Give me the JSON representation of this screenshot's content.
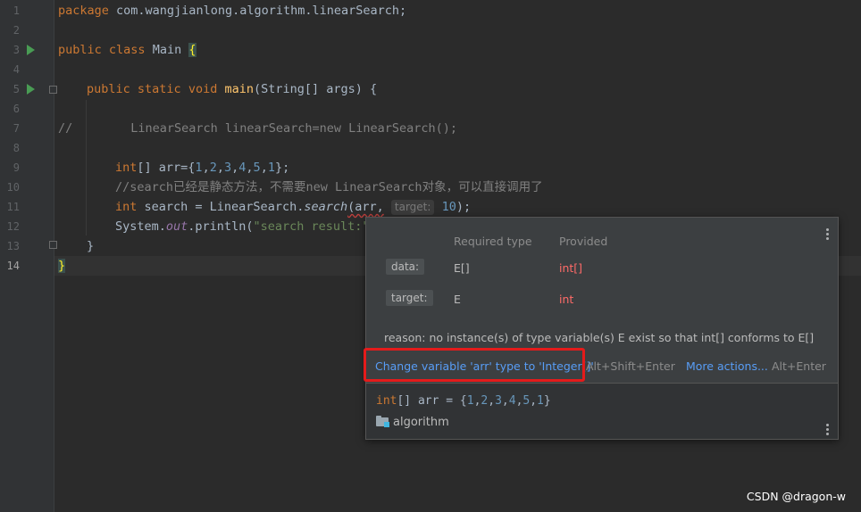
{
  "gutter": {
    "line_numbers": [
      "1",
      "2",
      "3",
      "4",
      "5",
      "6",
      "7",
      "8",
      "9",
      "10",
      "11",
      "12",
      "13",
      "14"
    ],
    "current_line": "14"
  },
  "code": {
    "l1": {
      "kw": "package",
      "rest": " com.wangjianlong.algorithm.linearSearch;"
    },
    "l3": {
      "kw1": "public",
      "kw2": "class",
      "name": "Main",
      "brace": "{"
    },
    "l5": {
      "kw1": "public",
      "kw2": "static",
      "kw3": "void",
      "fn": "main",
      "rest": "(String[] args) {"
    },
    "l7": {
      "comment": "//        LinearSearch linearSearch=new LinearSearch();"
    },
    "l9": {
      "kw": "int",
      "pre": "[] arr={",
      "n1": "1",
      "n2": "2",
      "n3": "3",
      "n4": "4",
      "n5": "5",
      "n6": "1",
      "post": "};"
    },
    "l10": {
      "comment": "//search已经是静态方法，不需要new LinearSearch对象，可以直接调用了"
    },
    "l11": {
      "kw": "int",
      "pre": " search = LinearSearch.",
      "method": "search",
      "arr": "(arr,",
      "hint": "target:",
      "num": "10",
      "post": ");"
    },
    "l12": {
      "pre": "System.",
      "field": "out",
      "mid": ".println(",
      "str": "\"search result:\""
    },
    "l13": {
      "brace": "}"
    },
    "l14": {
      "brace": "}"
    }
  },
  "popup": {
    "header_required": "Required type",
    "header_provided": "Provided",
    "rows": [
      {
        "param": "data:",
        "required": "E[]",
        "provided": "int[]"
      },
      {
        "param": "target:",
        "required": "E",
        "provided": "int"
      }
    ],
    "reason": "reason: no instance(s) of type variable(s) E exist so that int[] conforms to E[]",
    "action_label": "Change variable 'arr' type to 'Integer[]'",
    "action_shortcut": "Alt+Shift+Enter",
    "more_label": "More actions...",
    "more_shortcut": "Alt+Enter",
    "decl": {
      "kw": "int",
      "pre": "[] arr = {",
      "n1": "1",
      "n2": "2",
      "n3": "3",
      "n4": "4",
      "n5": "5",
      "n6": "1",
      "post": "}"
    },
    "package": "algorithm"
  },
  "watermark": "CSDN @dragon-w",
  "colors": {
    "keyword": "#cc7832",
    "number": "#6897bb",
    "error": "#ff6b68",
    "link": "#589df6",
    "highlight": "#e41b1b"
  }
}
